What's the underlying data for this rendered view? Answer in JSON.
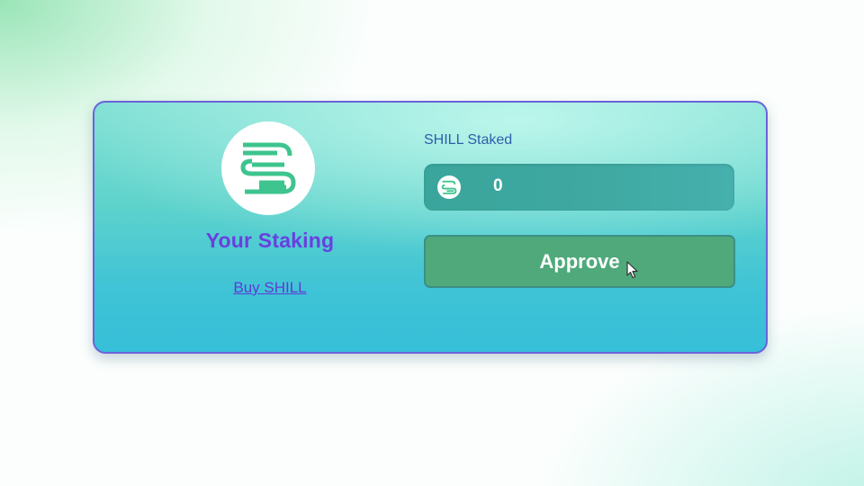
{
  "staking_card": {
    "title": "Your Staking",
    "buy_link": "Buy SHILL",
    "staked_label": "SHILL Staked",
    "staked_value": "0",
    "approve_button": "Approve"
  },
  "icons": {
    "logo": "shill-logo-icon",
    "token": "shill-token-icon",
    "cursor": "mouse-pointer-icon"
  },
  "colors": {
    "accent_purple": "#6a3fe0",
    "card_border": "#6b63d9",
    "button_green": "#4fa97b",
    "logo_green": "#3ec48e"
  }
}
